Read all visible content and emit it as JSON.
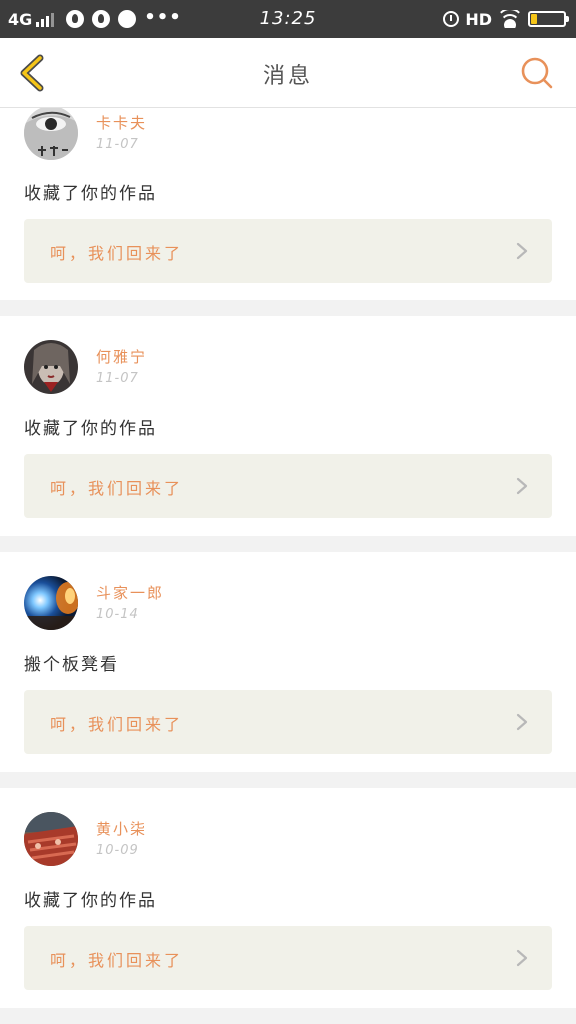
{
  "status_bar": {
    "network": "4G",
    "time": "13:25",
    "quality": "HD",
    "icons": [
      "signal-icon",
      "fire-icon",
      "fire-icon",
      "message-icon",
      "more-dots-icon",
      "alarm-icon",
      "wifi-icon",
      "battery-icon"
    ],
    "more": "•••"
  },
  "header": {
    "title": "消息",
    "accent": "#f5c518",
    "search_color": "#e8915a"
  },
  "colors": {
    "username": "#e8915a",
    "date": "#c4c4c4",
    "ref_bg": "#f1f1e9"
  },
  "messages": [
    {
      "user": "卡卡夫",
      "date": "11-07",
      "action": "收藏了你的作品",
      "ref": "呵，我们回来了"
    },
    {
      "user": "何雅宁",
      "date": "11-07",
      "action": "收藏了你的作品",
      "ref": "呵，我们回来了"
    },
    {
      "user": "斗家一郎",
      "date": "10-14",
      "action": "搬个板凳看",
      "ref": "呵，我们回来了"
    },
    {
      "user": "黄小柒",
      "date": "10-09",
      "action": "收藏了你的作品",
      "ref": "呵，我们回来了"
    }
  ]
}
